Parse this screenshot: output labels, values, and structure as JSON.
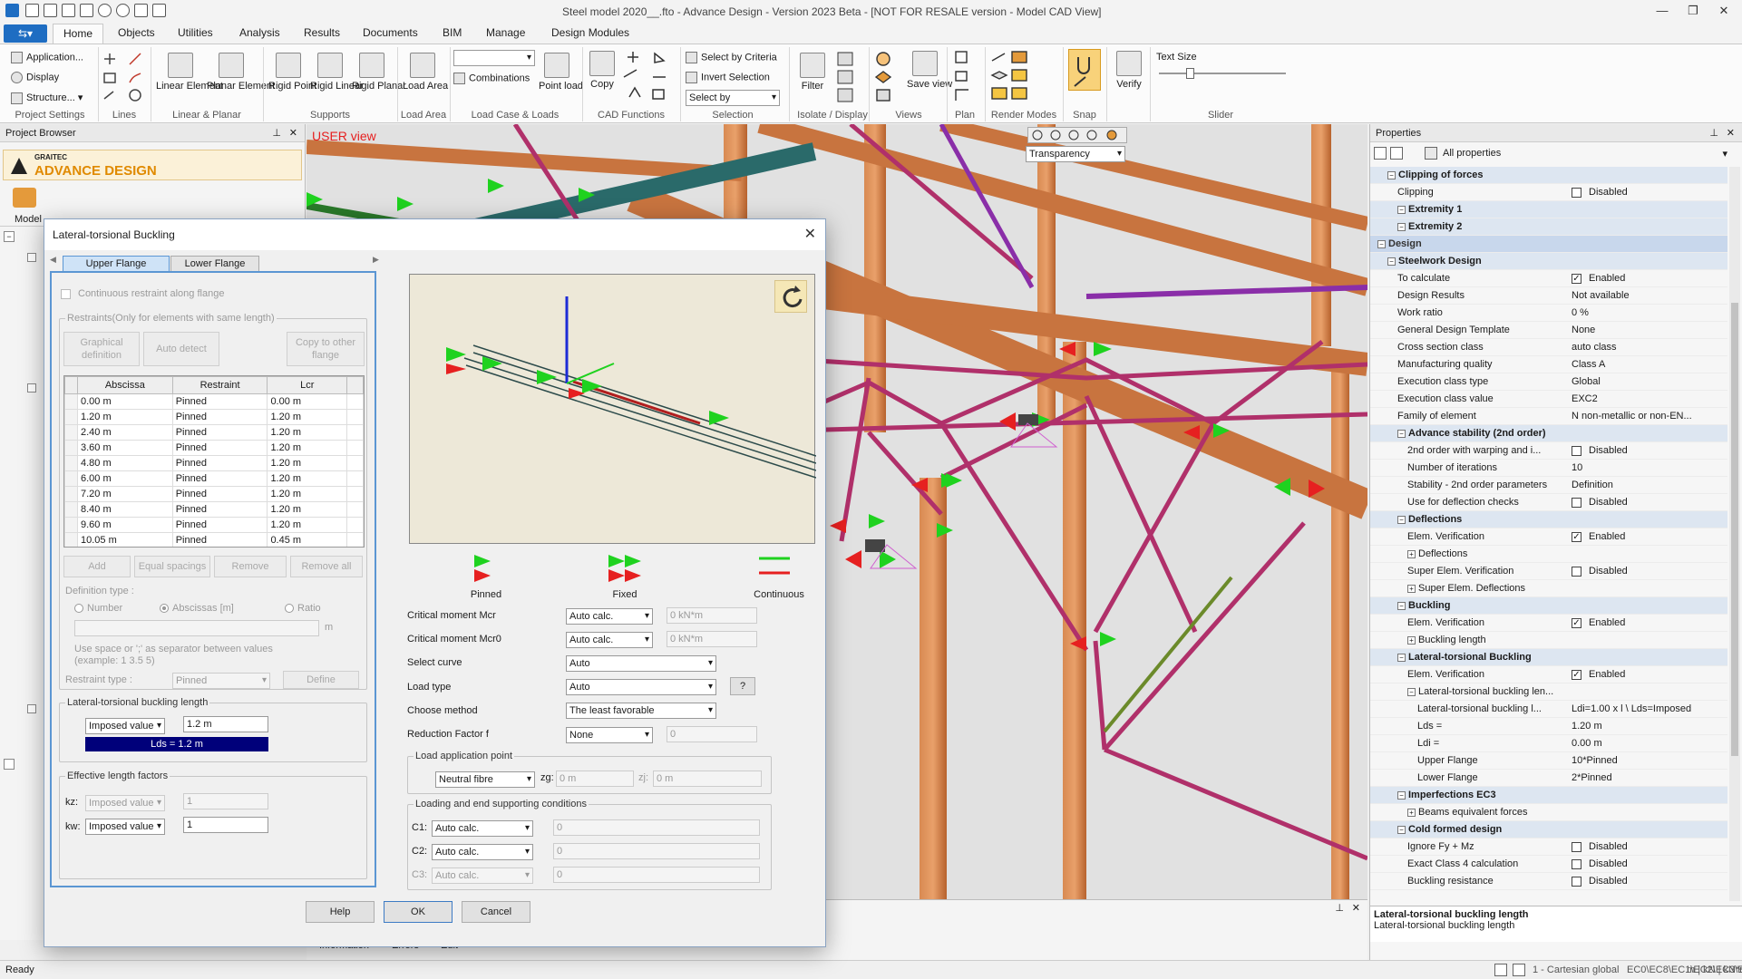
{
  "window": {
    "title": "Steel model 2020__.fto - Advance Design - Version 2023 Beta - [NOT FOR RESALE version - Model CAD View]"
  },
  "menu": {
    "tabs": [
      "Home",
      "Objects",
      "Utilities",
      "Analysis",
      "Results",
      "Documents",
      "BIM",
      "Manage",
      "Design Modules"
    ]
  },
  "ribbon": {
    "project_settings": {
      "application": "Application...",
      "display": "Display",
      "structure": "Structure...",
      "group": "Project Settings"
    },
    "lines": {
      "group": "Lines"
    },
    "linear_planar": {
      "linear": "Linear Element",
      "planar": "Planar Element",
      "group": "Linear & Planar"
    },
    "supports": {
      "rigid_point": "Rigid Point",
      "rigid_linear": "Rigid Linear",
      "rigid_planar": "Rigid Planar",
      "group": "Supports"
    },
    "load_area": {
      "label": "Load Area",
      "group": "Load Area"
    },
    "load_case": {
      "combinations": "Combinations",
      "point_load": "Point load",
      "group": "Load Case & Loads"
    },
    "cad": {
      "copy": "Copy",
      "group": "CAD Functions"
    },
    "selection": {
      "by_criteria": "Select by Criteria",
      "invert": "Invert Selection",
      "select_by": "Select by",
      "group": "Selection"
    },
    "isolate": {
      "filter": "Filter",
      "group": "Isolate / Display"
    },
    "views": {
      "save_view": "Save view",
      "group": "Views"
    },
    "plan": {
      "group": "Plan"
    },
    "render": {
      "group": "Render Modes"
    },
    "snap": {
      "group": "Snap"
    },
    "verify": {
      "label": "Verify"
    },
    "slider": {
      "text_size": "Text Size",
      "group": "Slider"
    }
  },
  "project_browser": {
    "title": "Project Browser",
    "brand_top": "GRAITEC",
    "brand": "ADVANCE DESIGN",
    "model_tab": "Model"
  },
  "viewport": {
    "view_label": "USER view",
    "transparency": "Transparency"
  },
  "bottom_tabs": [
    "Information",
    "Errors",
    "Edit"
  ],
  "dialog": {
    "title": "Lateral-torsional Buckling",
    "tabs": [
      "Upper Flange",
      "Lower Flange"
    ],
    "continuous_restraint": "Continuous restraint along flange",
    "restraints_group": "Restraints(Only for elements with same length)",
    "graphical_definition": "Graphical definition",
    "auto_detect": "Auto detect",
    "copy_other": "Copy to other flange",
    "table": {
      "headers": [
        "Abscissa",
        "Restraint",
        "Lcr"
      ],
      "rows": [
        [
          "0.00 m",
          "Pinned",
          "0.00 m"
        ],
        [
          "1.20 m",
          "Pinned",
          "1.20 m"
        ],
        [
          "2.40 m",
          "Pinned",
          "1.20 m"
        ],
        [
          "3.60 m",
          "Pinned",
          "1.20 m"
        ],
        [
          "4.80 m",
          "Pinned",
          "1.20 m"
        ],
        [
          "6.00 m",
          "Pinned",
          "1.20 m"
        ],
        [
          "7.20 m",
          "Pinned",
          "1.20 m"
        ],
        [
          "8.40 m",
          "Pinned",
          "1.20 m"
        ],
        [
          "9.60 m",
          "Pinned",
          "1.20 m"
        ],
        [
          "10.05 m",
          "Pinned",
          "0.45 m"
        ]
      ]
    },
    "add": "Add",
    "equal_spacings": "Equal spacings",
    "remove": "Remove",
    "remove_all": "Remove all",
    "definition_type": "Definition type :",
    "def_number": "Number",
    "def_abscissas": "Abscissas [m]",
    "def_ratio": "Ratio",
    "unit_m": "m",
    "hint": "Use space or ';' as separator between values",
    "example": "(example: 1  3.5  5)",
    "restraint_type_label": "Restraint type :",
    "restraint_type": "Pinned",
    "define": "Define",
    "ltb_length_group": "Lateral-torsional buckling length",
    "imposed_value": "Imposed value",
    "ltb_value": "1.2 m",
    "lds": "Lds = 1.2 m",
    "eff_group": "Effective length factors",
    "kz_label": "kz:",
    "kz_mode": "Imposed value",
    "kz_value": "1",
    "kw_label": "kw:",
    "kw_mode": "Imposed value",
    "kw_value": "1",
    "legend": {
      "pinned": "Pinned",
      "fixed": "Fixed",
      "continuous": "Continuous"
    },
    "mcr_label": "Critical moment Mcr",
    "mcr_mode": "Auto calc.",
    "mcr_value": "0 kN*m",
    "mcr0_label": "Critical moment Mcr0",
    "mcr0_mode": "Auto calc.",
    "mcr0_value": "0 kN*m",
    "curve_label": "Select curve",
    "curve_value": "Auto",
    "load_type_label": "Load type",
    "load_type_value": "Auto",
    "help_q": "?",
    "method_label": "Choose method",
    "method_value": "The least favorable",
    "reduction_label": "Reduction Factor f",
    "reduction_mode": "None",
    "reduction_value": "0",
    "lap_group": "Load application point",
    "lap_value": "Neutral fibre",
    "zg_label": "zg:",
    "zg_value": "0 m",
    "zj_label": "zj:",
    "zj_value": "0 m",
    "lesc_group": "Loading and end supporting conditions",
    "c1_label": "C1:",
    "c1_mode": "Auto calc.",
    "c1_value": "0",
    "c2_label": "C2:",
    "c2_mode": "Auto calc.",
    "c2_value": "0",
    "c3_label": "C3:",
    "c3_mode": "Auto calc.",
    "c3_value": "0",
    "help": "Help",
    "ok": "OK",
    "cancel": "Cancel"
  },
  "properties": {
    "title": "Properties",
    "filter": "All properties",
    "rows": [
      {
        "name": "Clipping of forces",
        "value": "",
        "level": 1,
        "type": "section",
        "check": ""
      },
      {
        "name": "Clipping",
        "value": "Disabled",
        "level": 2,
        "type": "item",
        "check": "off"
      },
      {
        "name": "Extremity 1",
        "value": "",
        "level": 2,
        "type": "section",
        "check": ""
      },
      {
        "name": "Extremity 2",
        "value": "",
        "level": 2,
        "type": "section",
        "check": ""
      },
      {
        "name": "Design",
        "value": "",
        "level": 0,
        "type": "main",
        "check": ""
      },
      {
        "name": "Steelwork Design",
        "value": "",
        "level": 1,
        "type": "section",
        "check": ""
      },
      {
        "name": "To calculate",
        "value": "Enabled",
        "level": 2,
        "type": "item",
        "check": "on"
      },
      {
        "name": "Design Results",
        "value": "Not available",
        "level": 2,
        "type": "item",
        "check": ""
      },
      {
        "name": "Work ratio",
        "value": "0 %",
        "level": 2,
        "type": "item",
        "check": ""
      },
      {
        "name": "General Design Template",
        "value": "None",
        "level": 2,
        "type": "item",
        "check": ""
      },
      {
        "name": "Cross section class",
        "value": "auto class",
        "level": 2,
        "type": "item",
        "check": ""
      },
      {
        "name": "Manufacturing quality",
        "value": "Class A",
        "level": 2,
        "type": "item",
        "check": ""
      },
      {
        "name": "Execution class type",
        "value": "Global",
        "level": 2,
        "type": "item",
        "check": ""
      },
      {
        "name": "Execution class value",
        "value": "EXC2",
        "level": 2,
        "type": "item",
        "check": ""
      },
      {
        "name": "Family of element",
        "value": "N non-metallic or non-EN...",
        "level": 2,
        "type": "item",
        "check": ""
      },
      {
        "name": "Advance stability (2nd order)",
        "value": "",
        "level": 2,
        "type": "section",
        "check": ""
      },
      {
        "name": "2nd order with warping and i...",
        "value": "Disabled",
        "level": 3,
        "type": "item",
        "check": "off"
      },
      {
        "name": "Number of iterations",
        "value": "10",
        "level": 3,
        "type": "item",
        "check": ""
      },
      {
        "name": "Stability - 2nd order parameters",
        "value": "Definition",
        "level": 3,
        "type": "item",
        "check": ""
      },
      {
        "name": "Use for deflection checks",
        "value": "Disabled",
        "level": 3,
        "type": "item",
        "check": "off"
      },
      {
        "name": "Deflections",
        "value": "",
        "level": 2,
        "type": "section",
        "check": ""
      },
      {
        "name": "Elem. Verification",
        "value": "Enabled",
        "level": 3,
        "type": "item",
        "check": "on"
      },
      {
        "name": "Deflections",
        "value": "",
        "level": 3,
        "type": "sub",
        "check": ""
      },
      {
        "name": "Super Elem. Verification",
        "value": "Disabled",
        "level": 3,
        "type": "item",
        "check": "off"
      },
      {
        "name": "Super Elem. Deflections",
        "value": "",
        "level": 3,
        "type": "sub",
        "check": ""
      },
      {
        "name": "Buckling",
        "value": "",
        "level": 2,
        "type": "section",
        "check": ""
      },
      {
        "name": "Elem. Verification",
        "value": "Enabled",
        "level": 3,
        "type": "item",
        "check": "on"
      },
      {
        "name": "Buckling length",
        "value": "",
        "level": 3,
        "type": "sub",
        "check": ""
      },
      {
        "name": "Lateral-torsional Buckling",
        "value": "",
        "level": 2,
        "type": "section",
        "check": ""
      },
      {
        "name": "Elem. Verification",
        "value": "Enabled",
        "level": 3,
        "type": "item",
        "check": "on"
      },
      {
        "name": "Lateral-torsional buckling len...",
        "value": "",
        "level": 3,
        "type": "subopen",
        "check": ""
      },
      {
        "name": "Lateral-torsional buckling l...",
        "value": "Ldi=1.00 x l \\ Lds=Imposed",
        "level": 4,
        "type": "item",
        "check": ""
      },
      {
        "name": "Lds =",
        "value": "1.20 m",
        "level": 4,
        "type": "item",
        "check": ""
      },
      {
        "name": "Ldi =",
        "value": "0.00 m",
        "level": 4,
        "type": "item",
        "check": ""
      },
      {
        "name": "Upper Flange",
        "value": "10*Pinned",
        "level": 4,
        "type": "item",
        "check": ""
      },
      {
        "name": "Lower Flange",
        "value": "2*Pinned",
        "level": 4,
        "type": "item",
        "check": ""
      },
      {
        "name": "Imperfections EC3",
        "value": "",
        "level": 2,
        "type": "section",
        "check": ""
      },
      {
        "name": "Beams equivalent forces",
        "value": "",
        "level": 3,
        "type": "sub",
        "check": ""
      },
      {
        "name": "Cold formed design",
        "value": "",
        "level": 2,
        "type": "section",
        "check": ""
      },
      {
        "name": "Ignore Fy + Mz",
        "value": "Disabled",
        "level": 3,
        "type": "item",
        "check": "off"
      },
      {
        "name": "Exact Class 4 calculation",
        "value": "Disabled",
        "level": 3,
        "type": "item",
        "check": "off"
      },
      {
        "name": "Buckling resistance",
        "value": "Disabled",
        "level": 3,
        "type": "item",
        "check": "off"
      }
    ],
    "desc_title": "Lateral-torsional buckling length",
    "desc_text": "Lateral-torsional buckling length"
  },
  "status": {
    "ready": "Ready",
    "coords": "1 - Cartesian global",
    "codes": "EC0\\EC8\\EC1\\EC2\\EC3\\EC5\\EC6",
    "units": "m | kN | kN*m | T"
  },
  "colors": {
    "accent": "#1e6dc2",
    "brand": "#e08a00",
    "beam_wood": "#c8743f",
    "truss_magenta": "#b0306a",
    "support_green": "#1fd21f",
    "support_red": "#e62020",
    "selection_blue": "#00007a"
  }
}
